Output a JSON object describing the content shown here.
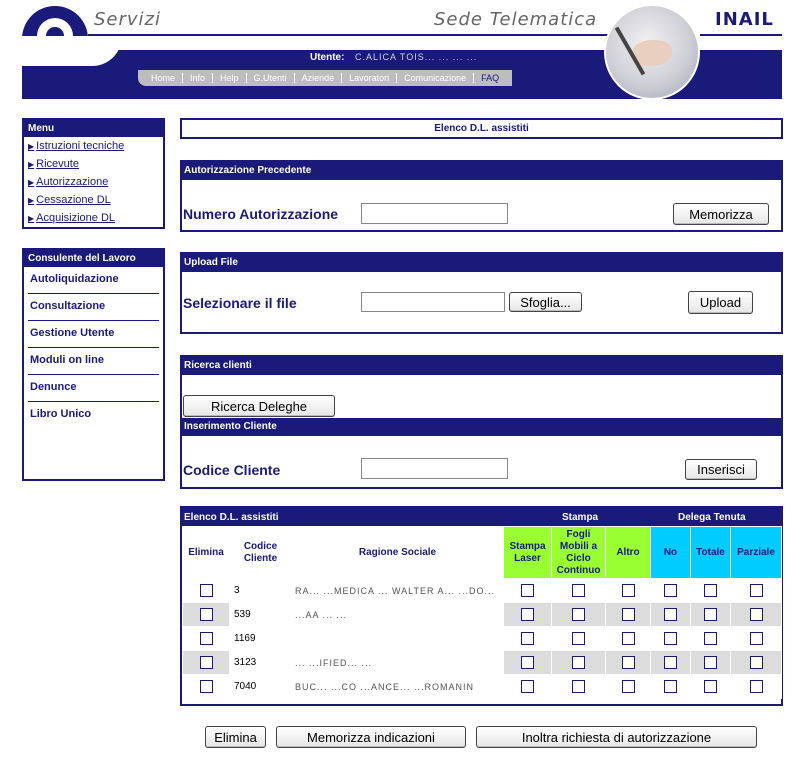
{
  "header": {
    "brand_left": "Servizi",
    "brand_mid": "Sede Telematica",
    "brand_right": "INAIL",
    "user_label": "Utente:",
    "user_value": "C.ALICA TOIS... ... ... ...",
    "nav": [
      "Home",
      "Info",
      "Help",
      "G.Utenti",
      "Aziende",
      "Lavoratori",
      "Comunicazione",
      "FAQ"
    ]
  },
  "menu": {
    "title": "Menu",
    "items": [
      "Istruzioni tecniche",
      "Ricevute",
      "Autorizzazione",
      "Cessazione DL",
      "Acquisizione DL"
    ]
  },
  "consulente": {
    "title": "Consulente del Lavoro",
    "items": [
      "Autoliquidazione",
      "Consultazione",
      "Gestione Utente",
      "Moduli on line",
      "Denunce",
      "Libro Unico"
    ]
  },
  "page_title": "Elenco D.L. assistiti",
  "autorizzazione": {
    "header": "Autorizzazione Precedente",
    "label": "Numero Autorizzazione",
    "input_value": "",
    "button": "Memorizza"
  },
  "upload": {
    "header": "Upload File",
    "label": "Selezionare il file",
    "input_value": "",
    "browse_button": "Sfoglia...",
    "upload_button": "Upload"
  },
  "ricerca": {
    "header": "Ricerca clienti",
    "button": "Ricerca Deleghe"
  },
  "inserimento": {
    "header": "Inserimento Cliente",
    "label": "Codice Cliente",
    "input_value": "",
    "button": "Inserisci"
  },
  "table": {
    "header": "Elenco D.L. assistiti",
    "group_stampa": "Stampa",
    "group_delega": "Delega Tenuta",
    "columns": [
      "Elimina",
      "Codice Cliente",
      "Ragione Sociale",
      "Stampa Laser",
      "Fogli Mobili a Ciclo Continuo",
      "Altro",
      "No",
      "Totale",
      "Parziale"
    ],
    "rows": [
      {
        "code": "3",
        "name": "RA... ...MEDICA ... WALTER A... ...DO..."
      },
      {
        "code": "539",
        "name": "...AA ... ..."
      },
      {
        "code": "1169",
        "name": ""
      },
      {
        "code": "3123",
        "name": "... ...IFIED... ..."
      },
      {
        "code": "7040",
        "name": "BUC... ...CO ...ANCE... ...ROMANIN"
      }
    ]
  },
  "footer_buttons": {
    "elimina": "Elimina",
    "memorizza": "Memorizza indicazioni",
    "inoltra": "Inoltra richiesta di autorizzazione"
  }
}
